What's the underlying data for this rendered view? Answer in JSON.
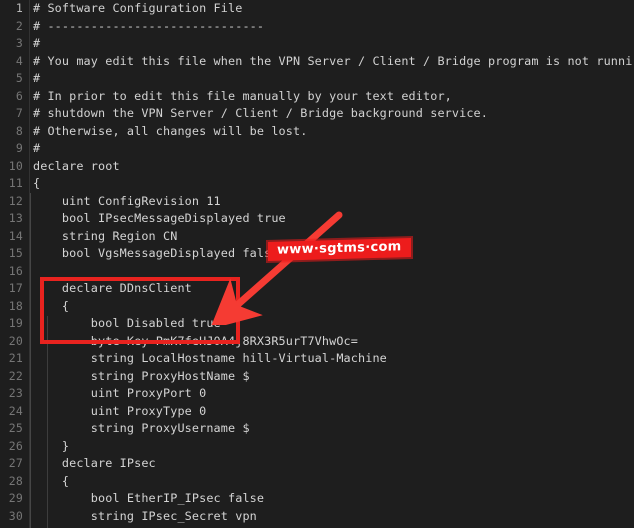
{
  "window": {
    "app": "code-editor",
    "theme": "dark",
    "background_color": "#1e1e1e",
    "gutter_color": "#1e1e1e",
    "text_color": "#d4d4d4",
    "line_number_color": "#767676",
    "accent_color": "#e8231f"
  },
  "editor": {
    "first_visible_line": 1,
    "last_visible_line": 30,
    "lines": [
      {
        "number": "1",
        "text": "# Software Configuration File",
        "kind": "comment"
      },
      {
        "number": "2",
        "text": "# ------------------------------",
        "kind": "comment"
      },
      {
        "number": "3",
        "text": "#",
        "kind": "comment"
      },
      {
        "number": "4",
        "text": "# You may edit this file when the VPN Server / Client / Bridge program is not runni",
        "kind": "comment"
      },
      {
        "number": "5",
        "text": "#",
        "kind": "comment"
      },
      {
        "number": "6",
        "text": "# In prior to edit this file manually by your text editor,",
        "kind": "comment"
      },
      {
        "number": "7",
        "text": "# shutdown the VPN Server / Client / Bridge background service.",
        "kind": "comment"
      },
      {
        "number": "8",
        "text": "# Otherwise, all changes will be lost.",
        "kind": "comment"
      },
      {
        "number": "9",
        "text": "#",
        "kind": "comment"
      },
      {
        "number": "10",
        "text": "declare root",
        "kind": "code"
      },
      {
        "number": "11",
        "text": "{",
        "kind": "code"
      },
      {
        "number": "12",
        "text": "    uint ConfigRevision 11",
        "kind": "code"
      },
      {
        "number": "13",
        "text": "    bool IPsecMessageDisplayed true",
        "kind": "code"
      },
      {
        "number": "14",
        "text": "    string Region CN",
        "kind": "code"
      },
      {
        "number": "15",
        "text": "    bool VgsMessageDisplayed false",
        "kind": "code"
      },
      {
        "number": "16",
        "text": "",
        "kind": "code"
      },
      {
        "number": "17",
        "text": "    declare DDnsClient",
        "kind": "code"
      },
      {
        "number": "18",
        "text": "    {",
        "kind": "code"
      },
      {
        "number": "19",
        "text": "        bool Disabled true",
        "kind": "code"
      },
      {
        "number": "20",
        "text": "        byte Key PmK7feHJ0A4j8RX3R5urT7VhwOc=",
        "kind": "code"
      },
      {
        "number": "21",
        "text": "        string LocalHostname hill-Virtual-Machine",
        "kind": "code"
      },
      {
        "number": "22",
        "text": "        string ProxyHostName $",
        "kind": "code"
      },
      {
        "number": "23",
        "text": "        uint ProxyPort 0",
        "kind": "code"
      },
      {
        "number": "24",
        "text": "        uint ProxyType 0",
        "kind": "code"
      },
      {
        "number": "25",
        "text": "        string ProxyUsername $",
        "kind": "code"
      },
      {
        "number": "26",
        "text": "    }",
        "kind": "code"
      },
      {
        "number": "27",
        "text": "    declare IPsec",
        "kind": "code"
      },
      {
        "number": "28",
        "text": "    {",
        "kind": "code"
      },
      {
        "number": "29",
        "text": "        bool EtherIP_IPsec false",
        "kind": "code"
      },
      {
        "number": "30",
        "text": "        string IPsec_Secret vpn",
        "kind": "code"
      }
    ]
  },
  "annotations": {
    "highlight_rect": {
      "name": "red-highlight-box",
      "color": "#e8231f",
      "covers_lines": "16-19"
    },
    "arrow": {
      "name": "red-arrow",
      "color": "#f53b33",
      "direction": "down-left"
    },
    "watermark": {
      "text": "www·sgtms·com",
      "color": "#ed1c1c",
      "text_color": "#ffffff"
    }
  }
}
